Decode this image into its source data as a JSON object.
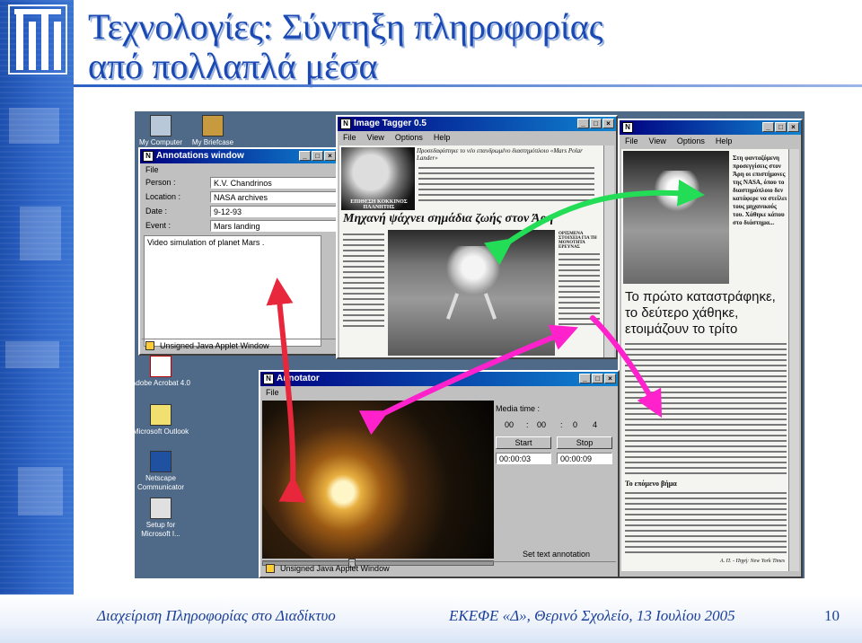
{
  "slide": {
    "title_line1": "Τεχνολογίες: Σύντηξη πληροφορίας",
    "title_line2": "από πολλαπλά μέσα",
    "footer_left": "Διαχείριση Πληροφορίας στο Διαδίκτυο",
    "footer_center": "ΕΚΕΦΕ «Δ», Θερινό Σχολείο, 13 Ιουλίου 2005",
    "page_number": "10"
  },
  "desktop_icons": [
    {
      "label": "My Computer",
      "icon": "computer-icon"
    },
    {
      "label": "My Briefcase",
      "icon": "briefcase-icon"
    },
    {
      "label": "Adobe Acrobat 4.0",
      "icon": "acrobat-icon"
    },
    {
      "label": "Microsoft Outlook",
      "icon": "outlook-icon"
    },
    {
      "label": "Netscape Communicator",
      "icon": "netscape-icon"
    },
    {
      "label": "Setup for Microsoft I...",
      "icon": "setup-icon"
    }
  ],
  "annotations_window": {
    "title": "Annotations window",
    "menu": [
      "File"
    ],
    "fields": [
      {
        "label": "Person :",
        "value": "K.V. Chandrinos"
      },
      {
        "label": "Location :",
        "value": "NASA archives"
      },
      {
        "label": "Date :",
        "value": "9-12-93"
      },
      {
        "label": "Event :",
        "value": "Mars landing"
      }
    ],
    "notes": "Video simulation of planet Mars .",
    "status": "Unsigned Java Applet Window"
  },
  "image_tagger_1": {
    "title": "Image Tagger 0.5",
    "menu": [
      "File",
      "View",
      "Options",
      "Help"
    ],
    "article_kicker": "Προσεδαφίστηκε το νέο επανδρωμένο διαστημόπλοιο «Mars Polar Lander»",
    "photo_caption": "ΕΠΙΘΕΣΗ ΚΟΚΚΙΝΟΣ ΠΛΑΝΗΤΗΣ",
    "headline": "Μηχανή ψάχνει σημάδια ζωής στον Άρη",
    "side_kicker": "ΟΡΙΣΜΕΝΑ ΣΤΟΙΧΕΙΑ ΓΙΑ ΤΗ ΜΟΝΟΤΗΤΑ ΕΡΕΥΝΑΣ"
  },
  "image_tagger_2": {
    "menu": [
      "File",
      "View",
      "Options",
      "Help"
    ],
    "caption": "Στη φανταζόμενη προσεγγίσεις στον Άρη οι επιστήμονες της NASA, όπου το διαστημόπλοιο δεν κατάφερε να στείλει τους μηχανικούς του. Χάθηκε κάπου στο διάστημα...",
    "headline": "Το πρώτο καταστράφηκε, το δεύτερο χάθηκε, ετοιμάζουν το τρίτο",
    "section": "Το επόμενο βήμα",
    "signature": "Α. Π. - Πηγή: New York Times"
  },
  "annotator": {
    "title": "Annotator",
    "menu": [
      "File"
    ],
    "media_time_label": "Media time :",
    "media_time": [
      "00",
      "00",
      "0",
      "4"
    ],
    "start_label": "Start",
    "stop_label": "Stop",
    "start_time": "00:00:03",
    "stop_time": "00:00:09",
    "set_text_label": "Set text annotation",
    "status": "Unsigned Java Applet Window",
    "seek_fraction": 0.38
  },
  "arrow_colors": {
    "red": "#e8263c",
    "green": "#22dd55",
    "magenta": "#ff22cc"
  }
}
